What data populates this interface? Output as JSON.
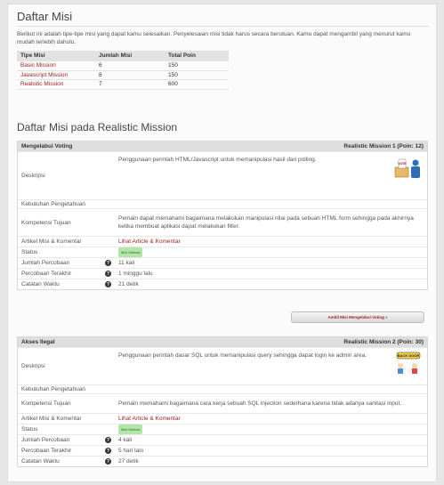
{
  "title": "Daftar Misi",
  "intro": "Berikut ini adalah tipe-tipe misi yang dapat kamu selesaikan. Penyelesaian misi tidak harus secara berutuan. Kamu dapat mengambil yang menurut kamu mudah terlebih dahulu.",
  "summary": {
    "headers": [
      "Tipe Misi",
      "Jumlah Misi",
      "Total Poin"
    ],
    "rows": [
      {
        "type": "Basic Mission",
        "count": "6",
        "points": "150"
      },
      {
        "type": "Javascript Mission",
        "count": "8",
        "points": "150"
      },
      {
        "type": "Realistic Mission",
        "count": "7",
        "points": "600"
      }
    ]
  },
  "section_title": "Daftar Misi pada Realistic Mission",
  "labels": {
    "deskripsi": "Deskripsi",
    "kebutuhan": "Kebutuhan Pengetahuan",
    "kompetensi": "Kompetensi Tujuan",
    "artikel": "Artikel Misi & Komentar",
    "status": "Status",
    "jumlah": "Jumlah Percobaan",
    "terakhir": "Percobaan Terakhir",
    "waktu": "Catatan Waktu",
    "help": "?"
  },
  "missions": [
    {
      "name": "Mengelabui Voting",
      "tag": "Realistic Mission 1 (Poin: 12)",
      "desc": "Penggunaan perintah HTML/Javascript untuk memanipulasi hasil dari polling.",
      "image": "vote-illustration",
      "kebutuhan": "",
      "kompetensi": "Pemain dapat memahami bagaimana melakukan manipulasi nilai pada sebuah HTML form sehingga pada akhirnya ketika membuat aplikasi dapat melakukan filter.",
      "artikel": "Lihat Article & Komentar",
      "status": "Misi Selesai",
      "jumlah": "11 kali",
      "terakhir": "1 minggu lalu",
      "waktu": "21 detik",
      "button": "Ambil Misi Mengelabui Voting »"
    },
    {
      "name": "Akses Ilegal",
      "tag": "Realistic Mission 2 (Poin: 30)",
      "desc": "Penggunaan perintah dasar SQL untuk memanipulasi query sehingga dapat login ke admin area.",
      "image": "backdoor-illustration",
      "kebutuhan": "",
      "kompetensi": "Pemain memahami bagaimana cara kerja sebuah SQL injection sederhana karena tidak adanya sanitasi input.",
      "artikel": "Lihat Article & Komentar",
      "status": "Misi Selesai",
      "jumlah": "4 kali",
      "terakhir": "5 hari lalu",
      "waktu": "27 detik"
    }
  ],
  "colors": {
    "link": "#9b1c1c",
    "status_bg": "#b3e5a8",
    "header_bg": "#dedede"
  }
}
